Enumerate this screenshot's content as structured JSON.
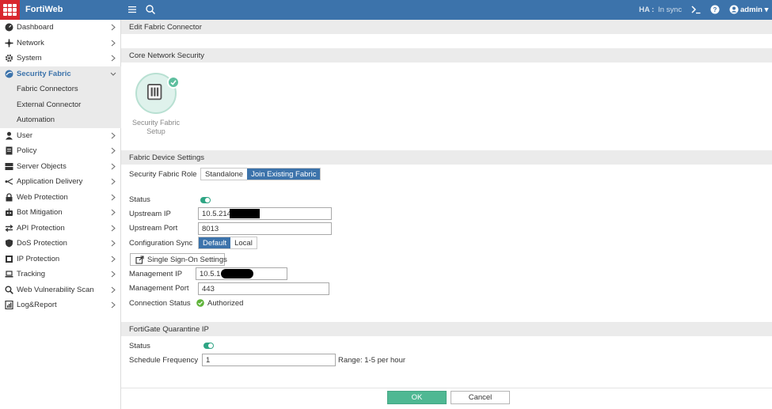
{
  "header": {
    "brand": "FortiWeb",
    "ha_label": "HA :",
    "ha_status": "In sync",
    "user": "admin"
  },
  "sidebar": {
    "items": [
      {
        "label": "Dashboard",
        "icon": "dashboard-icon"
      },
      {
        "label": "Network",
        "icon": "network-icon"
      },
      {
        "label": "System",
        "icon": "gear-icon"
      },
      {
        "label": "Security Fabric",
        "icon": "security-fabric-icon",
        "active": true
      },
      {
        "label": "User",
        "icon": "user-icon"
      },
      {
        "label": "Policy",
        "icon": "policy-icon"
      },
      {
        "label": "Server Objects",
        "icon": "server-objects-icon"
      },
      {
        "label": "Application Delivery",
        "icon": "application-delivery-icon"
      },
      {
        "label": "Web Protection",
        "icon": "lock-icon"
      },
      {
        "label": "Bot Mitigation",
        "icon": "bot-icon"
      },
      {
        "label": "API Protection",
        "icon": "api-icon"
      },
      {
        "label": "DoS Protection",
        "icon": "shield-icon"
      },
      {
        "label": "IP Protection",
        "icon": "ip-protection-icon"
      },
      {
        "label": "Tracking",
        "icon": "laptop-icon"
      },
      {
        "label": "Web Vulnerability Scan",
        "icon": "scan-icon"
      },
      {
        "label": "Log&Report",
        "icon": "report-icon"
      }
    ],
    "subitems": [
      "Fabric Connectors",
      "External Connector",
      "Automation"
    ]
  },
  "page": {
    "title": "Edit Fabric Connector",
    "core_section": "Core Network Security",
    "tile_label_1": "Security Fabric",
    "tile_label_2": "Setup",
    "fabric_section": "Fabric Device Settings",
    "role_label": "Security Fabric Role",
    "role_options": [
      "Standalone",
      "Join Existing Fabric"
    ],
    "role_selected": "Join Existing Fabric",
    "status_label": "Status",
    "status_on": true,
    "upstream_ip_label": "Upstream IP",
    "upstream_ip_value": "10.5.214",
    "upstream_port_label": "Upstream Port",
    "upstream_port_value": "8013",
    "config_sync_label": "Configuration Sync",
    "config_sync_options": [
      "Default",
      "Local"
    ],
    "config_sync_selected": "Default",
    "sso_button": "Single Sign-On Settings",
    "mgmt_ip_label": "Management IP",
    "mgmt_ip_value": "10.5.1",
    "mgmt_port_label": "Management Port",
    "mgmt_port_value": "443",
    "conn_status_label": "Connection Status",
    "conn_status_value": "Authorized",
    "quarantine_section": "FortiGate Quarantine IP",
    "q_status_label": "Status",
    "q_status_on": true,
    "schedule_label": "Schedule Frequency",
    "schedule_value": "1",
    "schedule_hint": "Range: 1-5 per hour"
  },
  "buttons": {
    "ok": "OK",
    "cancel": "Cancel"
  },
  "colors": {
    "header_bg": "#3c73ab",
    "logo_bg": "#d8272e",
    "accent": "#3c73ab",
    "ok_button": "#4fb893",
    "toggle_on": "#2fa584"
  }
}
